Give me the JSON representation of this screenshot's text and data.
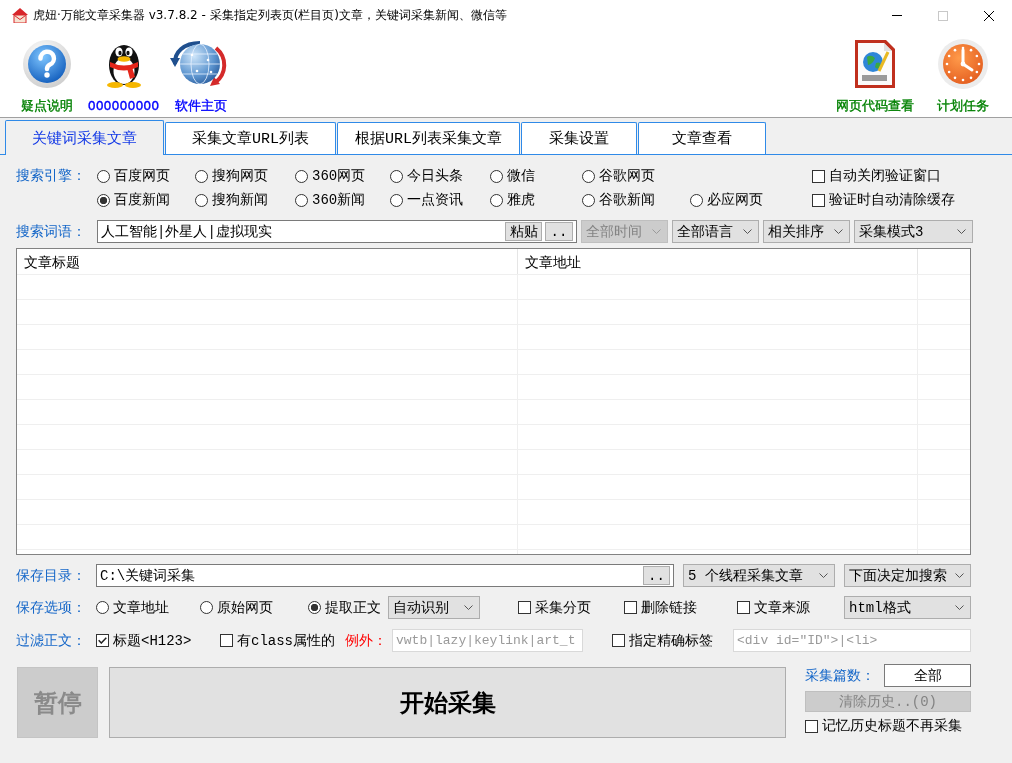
{
  "window": {
    "title": "虎妞·万能文章采集器 v3.7.8.2 - 采集指定列表页(栏目页)文章，关键词采集新闻、微信等"
  },
  "toolbar": {
    "left": [
      {
        "kind": "help",
        "label": "疑点说明",
        "color": "#008000"
      },
      {
        "kind": "penguin",
        "label": "000000000",
        "color": "#0000ff"
      },
      {
        "kind": "globe",
        "label": "软件主页",
        "color": "#0000ff"
      }
    ],
    "right": [
      {
        "kind": "html",
        "label": "网页代码查看",
        "color": "#008000"
      },
      {
        "kind": "clock",
        "label": "计划任务",
        "color": "#008000"
      }
    ]
  },
  "tabs": [
    {
      "label": "关键词采集文章",
      "selected": true
    },
    {
      "label": "采集文章URL列表",
      "selected": false
    },
    {
      "label": "根据URL列表采集文章",
      "selected": false
    },
    {
      "label": "采集设置",
      "selected": false
    },
    {
      "label": "文章查看",
      "selected": false
    }
  ],
  "search_engine": {
    "label": "搜索引擎：",
    "rows": [
      [
        {
          "label": "百度网页",
          "selected": false
        },
        {
          "label": "搜狗网页",
          "selected": false
        },
        {
          "label": "360网页",
          "selected": false
        },
        {
          "label": "今日头条",
          "selected": false
        },
        {
          "label": "微信",
          "selected": false
        },
        {
          "label": "谷歌网页",
          "selected": false
        }
      ],
      [
        {
          "label": "百度新闻",
          "selected": true
        },
        {
          "label": "搜狗新闻",
          "selected": false
        },
        {
          "label": "360新闻",
          "selected": false
        },
        {
          "label": "一点资讯",
          "selected": false
        },
        {
          "label": "雅虎",
          "selected": false
        },
        {
          "label": "谷歌新闻",
          "selected": false
        },
        {
          "label": "必应网页",
          "selected": false
        }
      ]
    ],
    "checkboxes": [
      {
        "label": "自动关闭验证窗口",
        "checked": false
      },
      {
        "label": "验证时自动清除缓存",
        "checked": false
      }
    ]
  },
  "search_terms": {
    "label": "搜索词语：",
    "value": "人工智能|外星人|虚拟现实",
    "buttons": [
      "粘贴",
      ".."
    ],
    "dropdowns": [
      {
        "value": "全部时间",
        "disabled": true
      },
      {
        "value": "全部语言",
        "disabled": false
      },
      {
        "value": "相关排序",
        "disabled": false
      },
      {
        "value": "采集模式3",
        "disabled": false
      }
    ]
  },
  "table": {
    "columns": [
      "文章标题",
      "文章地址"
    ]
  },
  "save_dir": {
    "label": "保存目录：",
    "value": "C:\\关键词采集",
    "button": "..",
    "dropdowns": [
      {
        "value": "5 个线程采集文章",
        "disabled": false
      },
      {
        "value": "下面决定加搜索",
        "disabled": false
      }
    ]
  },
  "save_options": {
    "label": "保存选项：",
    "radios": [
      {
        "label": "文章地址",
        "selected": false
      },
      {
        "label": "原始网页",
        "selected": false
      },
      {
        "label": "提取正文",
        "selected": true
      }
    ],
    "extract_dropdown": {
      "value": "自动识别",
      "disabled": false
    },
    "checkboxes": [
      {
        "label": "采集分页",
        "checked": false
      },
      {
        "label": "删除链接",
        "checked": false
      },
      {
        "label": "文章来源",
        "checked": false
      }
    ],
    "format_dropdown": {
      "value": "html格式",
      "disabled": false
    }
  },
  "filter": {
    "label": "过滤正文：",
    "title_checkbox": {
      "label": "标题<H123>",
      "checked": true
    },
    "class_checkbox": {
      "label": "有class属性的",
      "checked": false
    },
    "exception_label": "例外：",
    "exception_field": {
      "placeholder": "vwtb|lazy|keylink|art_t"
    },
    "exact_tag_checkbox": {
      "label": "指定精确标签",
      "checked": false
    },
    "exact_tag_field": {
      "placeholder": "<div id=\"ID\">|<li>"
    }
  },
  "actions": {
    "pause": {
      "label": "暂停",
      "disabled": true
    },
    "start": {
      "label": "开始采集",
      "disabled": false
    },
    "count_label": "采集篇数：",
    "count_value": "全部",
    "clear_history": {
      "label": "清除历史..(0)",
      "disabled": true
    },
    "remember_checkbox": {
      "label": "记忆历史标题不再采集",
      "checked": false
    }
  }
}
